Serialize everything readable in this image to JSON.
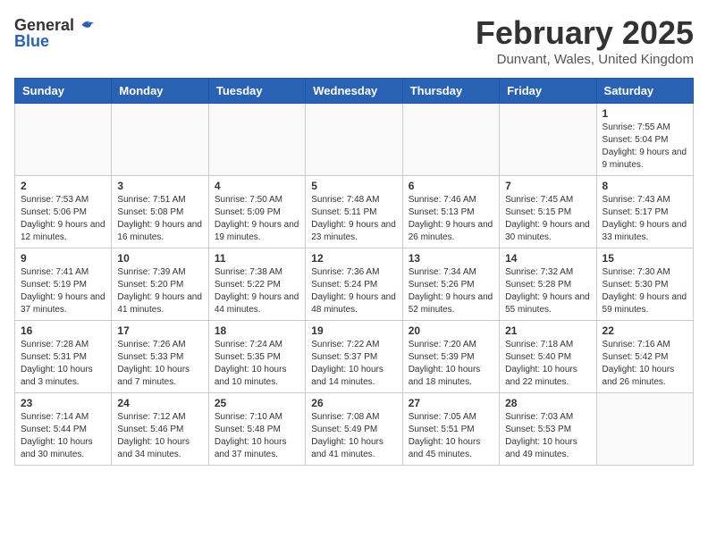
{
  "header": {
    "logo_general": "General",
    "logo_blue": "Blue",
    "title": "February 2025",
    "subtitle": "Dunvant, Wales, United Kingdom"
  },
  "days_of_week": [
    "Sunday",
    "Monday",
    "Tuesday",
    "Wednesday",
    "Thursday",
    "Friday",
    "Saturday"
  ],
  "weeks": [
    [
      {
        "day": "",
        "empty": true
      },
      {
        "day": "",
        "empty": true
      },
      {
        "day": "",
        "empty": true
      },
      {
        "day": "",
        "empty": true
      },
      {
        "day": "",
        "empty": true
      },
      {
        "day": "",
        "empty": true
      },
      {
        "day": "1",
        "sunrise": "7:55 AM",
        "sunset": "5:04 PM",
        "daylight": "9 hours and 9 minutes."
      }
    ],
    [
      {
        "day": "2",
        "sunrise": "7:53 AM",
        "sunset": "5:06 PM",
        "daylight": "9 hours and 12 minutes."
      },
      {
        "day": "3",
        "sunrise": "7:51 AM",
        "sunset": "5:08 PM",
        "daylight": "9 hours and 16 minutes."
      },
      {
        "day": "4",
        "sunrise": "7:50 AM",
        "sunset": "5:09 PM",
        "daylight": "9 hours and 19 minutes."
      },
      {
        "day": "5",
        "sunrise": "7:48 AM",
        "sunset": "5:11 PM",
        "daylight": "9 hours and 23 minutes."
      },
      {
        "day": "6",
        "sunrise": "7:46 AM",
        "sunset": "5:13 PM",
        "daylight": "9 hours and 26 minutes."
      },
      {
        "day": "7",
        "sunrise": "7:45 AM",
        "sunset": "5:15 PM",
        "daylight": "9 hours and 30 minutes."
      },
      {
        "day": "8",
        "sunrise": "7:43 AM",
        "sunset": "5:17 PM",
        "daylight": "9 hours and 33 minutes."
      }
    ],
    [
      {
        "day": "9",
        "sunrise": "7:41 AM",
        "sunset": "5:19 PM",
        "daylight": "9 hours and 37 minutes."
      },
      {
        "day": "10",
        "sunrise": "7:39 AM",
        "sunset": "5:20 PM",
        "daylight": "9 hours and 41 minutes."
      },
      {
        "day": "11",
        "sunrise": "7:38 AM",
        "sunset": "5:22 PM",
        "daylight": "9 hours and 44 minutes."
      },
      {
        "day": "12",
        "sunrise": "7:36 AM",
        "sunset": "5:24 PM",
        "daylight": "9 hours and 48 minutes."
      },
      {
        "day": "13",
        "sunrise": "7:34 AM",
        "sunset": "5:26 PM",
        "daylight": "9 hours and 52 minutes."
      },
      {
        "day": "14",
        "sunrise": "7:32 AM",
        "sunset": "5:28 PM",
        "daylight": "9 hours and 55 minutes."
      },
      {
        "day": "15",
        "sunrise": "7:30 AM",
        "sunset": "5:30 PM",
        "daylight": "9 hours and 59 minutes."
      }
    ],
    [
      {
        "day": "16",
        "sunrise": "7:28 AM",
        "sunset": "5:31 PM",
        "daylight": "10 hours and 3 minutes."
      },
      {
        "day": "17",
        "sunrise": "7:26 AM",
        "sunset": "5:33 PM",
        "daylight": "10 hours and 7 minutes."
      },
      {
        "day": "18",
        "sunrise": "7:24 AM",
        "sunset": "5:35 PM",
        "daylight": "10 hours and 10 minutes."
      },
      {
        "day": "19",
        "sunrise": "7:22 AM",
        "sunset": "5:37 PM",
        "daylight": "10 hours and 14 minutes."
      },
      {
        "day": "20",
        "sunrise": "7:20 AM",
        "sunset": "5:39 PM",
        "daylight": "10 hours and 18 minutes."
      },
      {
        "day": "21",
        "sunrise": "7:18 AM",
        "sunset": "5:40 PM",
        "daylight": "10 hours and 22 minutes."
      },
      {
        "day": "22",
        "sunrise": "7:16 AM",
        "sunset": "5:42 PM",
        "daylight": "10 hours and 26 minutes."
      }
    ],
    [
      {
        "day": "23",
        "sunrise": "7:14 AM",
        "sunset": "5:44 PM",
        "daylight": "10 hours and 30 minutes."
      },
      {
        "day": "24",
        "sunrise": "7:12 AM",
        "sunset": "5:46 PM",
        "daylight": "10 hours and 34 minutes."
      },
      {
        "day": "25",
        "sunrise": "7:10 AM",
        "sunset": "5:48 PM",
        "daylight": "10 hours and 37 minutes."
      },
      {
        "day": "26",
        "sunrise": "7:08 AM",
        "sunset": "5:49 PM",
        "daylight": "10 hours and 41 minutes."
      },
      {
        "day": "27",
        "sunrise": "7:05 AM",
        "sunset": "5:51 PM",
        "daylight": "10 hours and 45 minutes."
      },
      {
        "day": "28",
        "sunrise": "7:03 AM",
        "sunset": "5:53 PM",
        "daylight": "10 hours and 49 minutes."
      },
      {
        "day": "",
        "empty": true
      }
    ]
  ]
}
